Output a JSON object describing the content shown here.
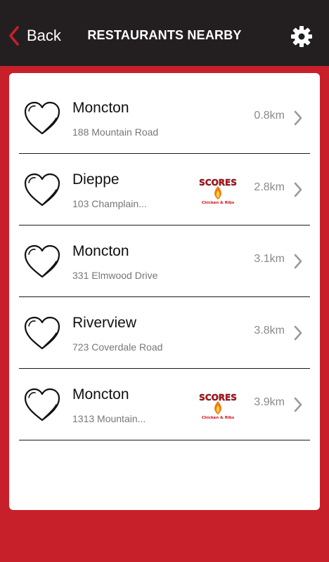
{
  "header": {
    "back_label": "Back",
    "title": "RESTAURANTS NEARBY",
    "back_icon": "chevron-left-icon",
    "settings_icon": "gear-icon"
  },
  "colors": {
    "brand_red": "#c8202a",
    "header_bg": "#231f20",
    "card_bg": "#ffffff",
    "distance_text": "#8a8a8a"
  },
  "restaurants": [
    {
      "city": "Moncton",
      "address": "188 Mountain Road",
      "distance": "0.8km",
      "favorite_icon": "heart-outline-icon",
      "has_logo": false
    },
    {
      "city": "Dieppe",
      "address": "103 Champlain...",
      "distance": "2.8km",
      "favorite_icon": "heart-outline-icon",
      "has_logo": true
    },
    {
      "city": "Moncton",
      "address": "331 Elmwood Drive",
      "distance": "3.1km",
      "favorite_icon": "heart-outline-icon",
      "has_logo": false
    },
    {
      "city": "Riverview",
      "address": "723 Coverdale Road",
      "distance": "3.8km",
      "favorite_icon": "heart-outline-icon",
      "has_logo": false
    },
    {
      "city": "Moncton",
      "address": "1313 Mountain...",
      "distance": "3.9km",
      "favorite_icon": "heart-outline-icon",
      "has_logo": true
    }
  ],
  "logo": {
    "brand": "SCORES",
    "tagline": "Chicken & Ribs"
  }
}
